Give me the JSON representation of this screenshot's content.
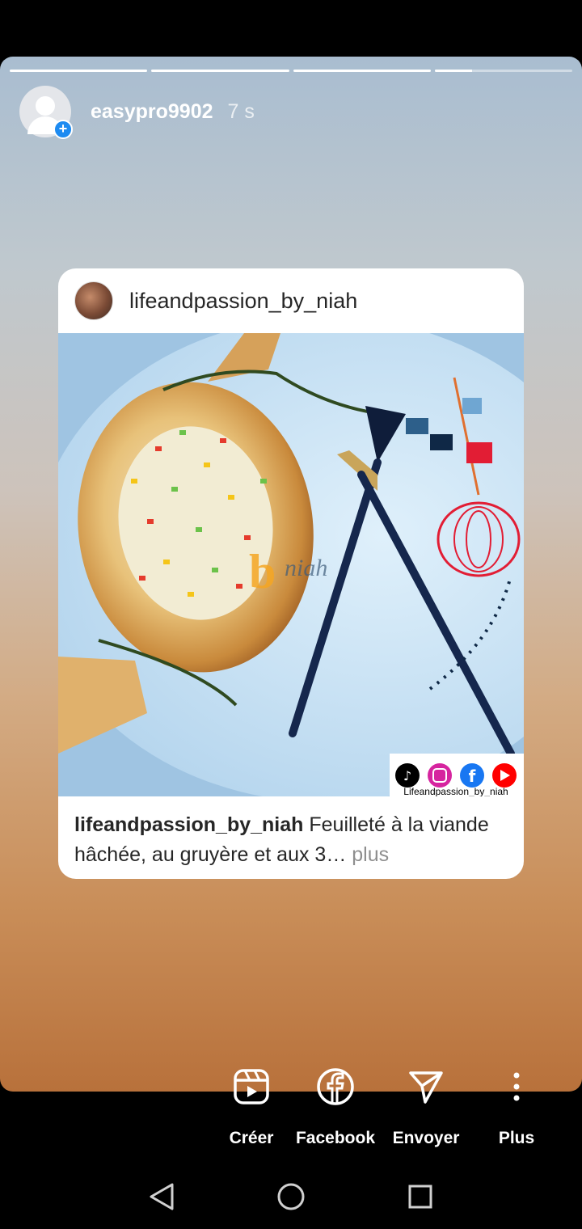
{
  "story": {
    "progress": [
      1,
      1,
      1,
      0.27
    ],
    "username": "easypro9902",
    "time": "7 s"
  },
  "post": {
    "username": "lifeandpassion_by_niah",
    "image": {
      "watermark": "niah",
      "social_caption": "Lifeandpassion_by_niah"
    },
    "caption": {
      "user": "lifeandpassion_by_niah",
      "text": "Feuilleté à la viande hâchée, au gruyère et aux 3…",
      "more": "plus"
    }
  },
  "actions": [
    {
      "label": "Créer",
      "icon": "reels-icon"
    },
    {
      "label": "Facebook",
      "icon": "facebook-icon"
    },
    {
      "label": "Envoyer",
      "icon": "send-icon"
    },
    {
      "label": "Plus",
      "icon": "more-vertical-icon"
    }
  ],
  "nav": {
    "back": "back-icon",
    "home": "home-icon",
    "recents": "recents-icon"
  }
}
